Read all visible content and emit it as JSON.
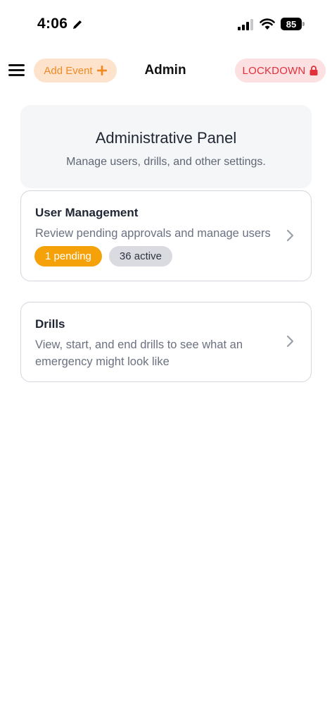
{
  "status_bar": {
    "time": "4:06",
    "battery": "85"
  },
  "header": {
    "add_event_label": "Add Event",
    "title": "Admin",
    "lockdown_label": "LOCKDOWN"
  },
  "panel": {
    "title": "Administrative Panel",
    "subtitle": "Manage users, drills, and other settings."
  },
  "cards": [
    {
      "title": "User Management",
      "description": "Review pending approvals and manage users",
      "badges": [
        "1 pending",
        "36 active"
      ]
    },
    {
      "title": "Drills",
      "description": "View, start, and end drills to see what an emergency might look like"
    }
  ],
  "colors": {
    "add_event_accent": "#f08a24",
    "lockdown_accent": "#e0313b",
    "pending_badge": "#f5a20a"
  }
}
